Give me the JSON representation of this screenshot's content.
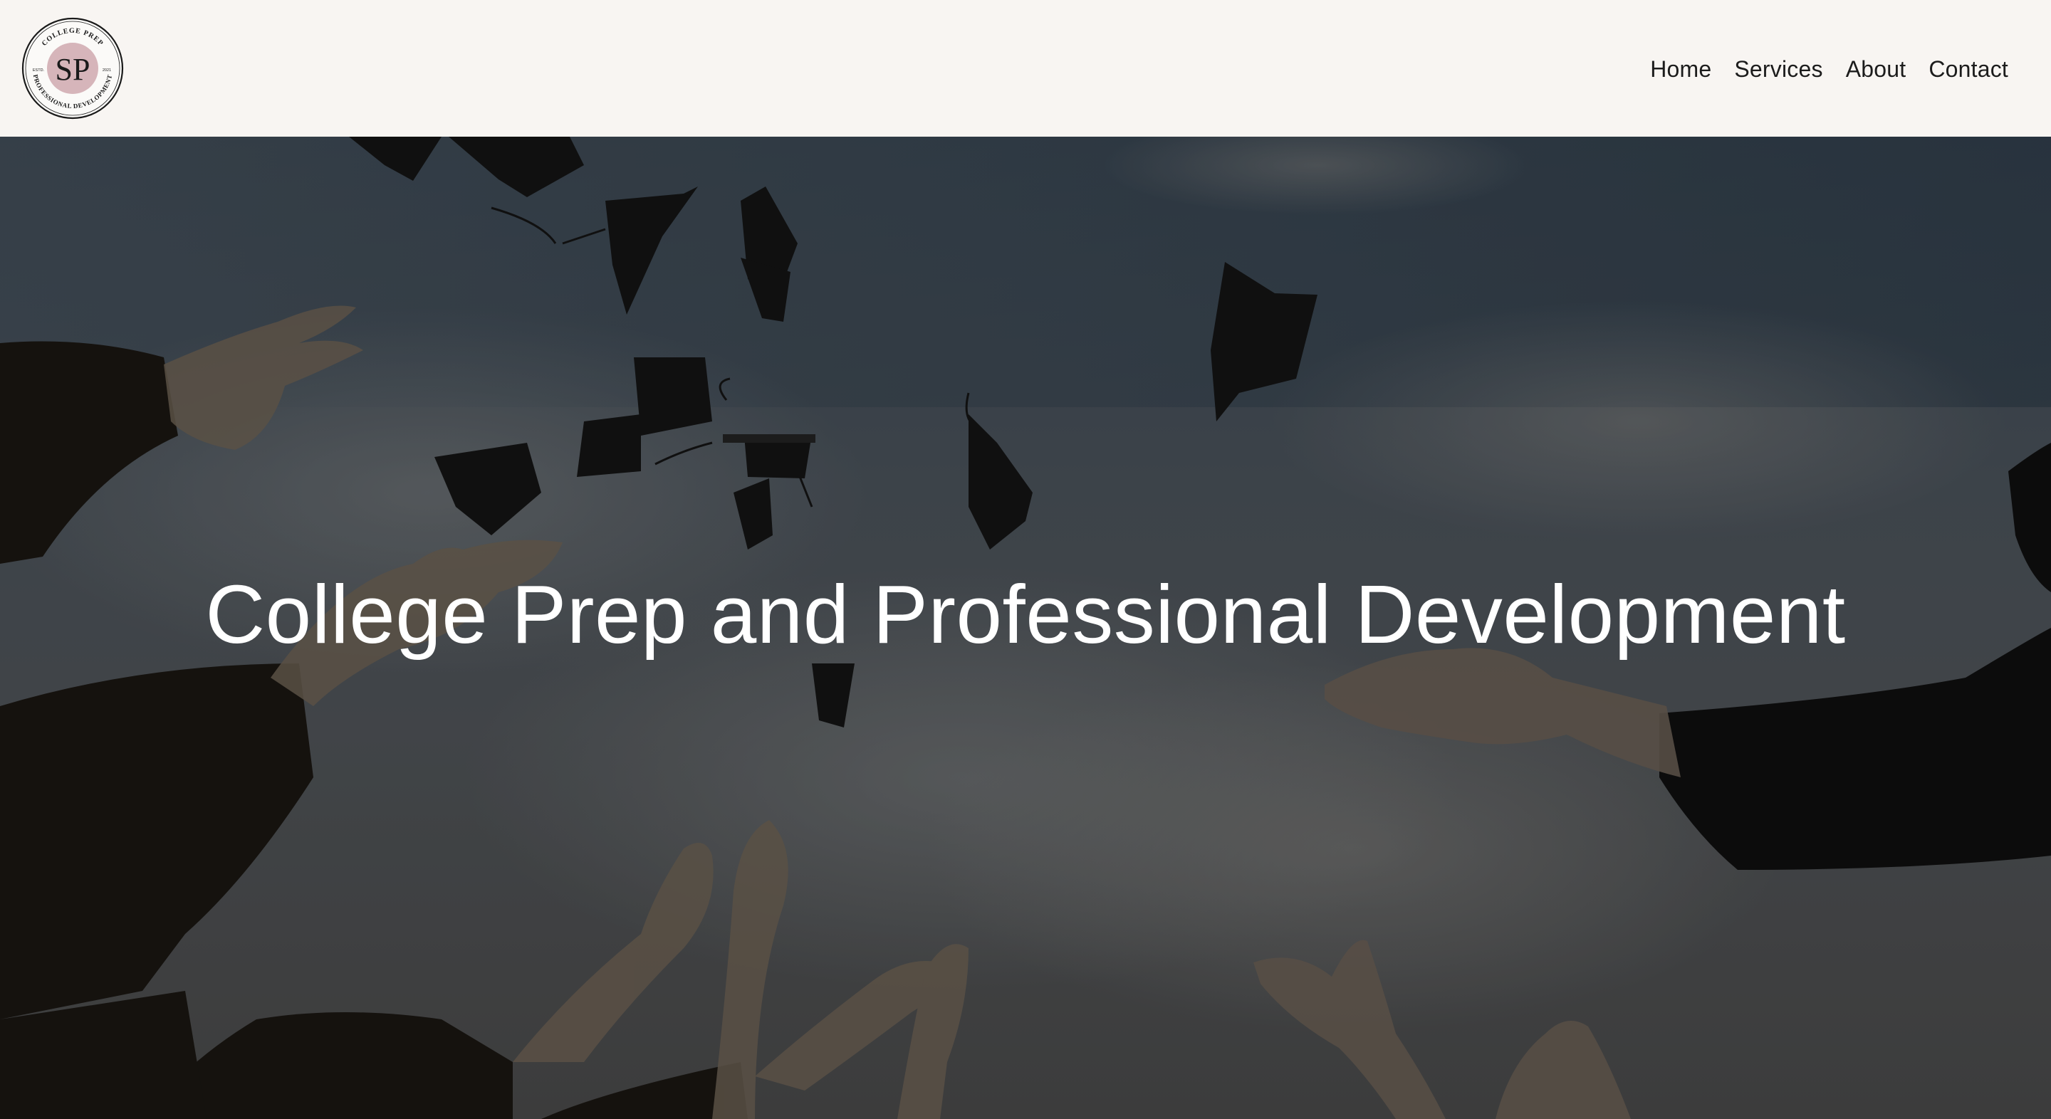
{
  "header": {
    "logo": {
      "monogram": "SP",
      "ring_top": "COLLEGE PREP",
      "ring_bottom": "PROFESSIONAL DEVELOPMENT",
      "est_left": "ESTD.",
      "est_right": "2021"
    },
    "nav": [
      {
        "label": "Home"
      },
      {
        "label": "Services"
      },
      {
        "label": "About"
      },
      {
        "label": "Contact"
      }
    ]
  },
  "hero": {
    "title": "College Prep and Professional Development",
    "background": "graduation-caps-thrown-in-sky-photo"
  },
  "colors": {
    "header_bg": "#f8f5f2",
    "nav_text": "#1c1c1c",
    "logo_pink": "#d6b5ba",
    "hero_text": "#ffffff"
  }
}
